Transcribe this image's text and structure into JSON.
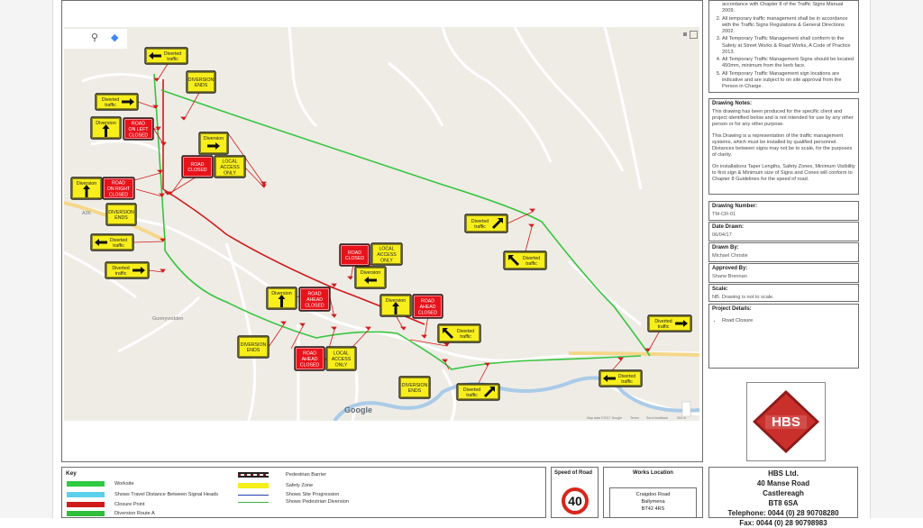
{
  "traffic_notes": {
    "items": [
      "accordance with Chapter 8 of the Traffic Signs Manual 2009.",
      "All temporary traffic management shall be in accordance with the Traffic Signs Regulations & General Directions 2002.",
      "All Temporary Traffic Management shall conform to the Safety at Street Works & Road Works, A Code of Practice 2013.",
      "All Temporary Traffic Management Signs should be located 450mm, minimum from the kerb face.",
      "All Temporary Traffic Management sign locations are indicative and are subject to on site approval from the Person in Charge."
    ],
    "numbers": [
      "2.",
      "3.",
      "4.",
      "5."
    ]
  },
  "drawing_notes": {
    "title": "Drawing Notes:",
    "paragraphs": [
      "This drawing has been produced for the specific client and project identified below and is not intended for use by any other person or for any other purpose.",
      "This Drawing is a representation of the traffic management systems, which must be installed by qualified personnel. Distances between signs may not be to scale, for the purposes of clarity.",
      "On installations Taper Lengths, Safety Zones, Minimum Visibility to first sign & Minimum size of Signs and Cones will conform to Chapter 8 Guidelines for the speed of road."
    ]
  },
  "fields": {
    "drawing_number_label": "Drawing Number:",
    "drawing_number": "TM-CR-01",
    "date_label": "Date Drawn:",
    "date": "06/04/17",
    "drawn_by_label": "Drawn By:",
    "drawn_by": "Michael Christie",
    "approved_by_label": "Approved By:",
    "approved_by": "Shane Brennan",
    "scale_label": "Scale:",
    "scale": "NB. Drawing is not to scale.",
    "project_label": "Project Details:",
    "project": "Road Closure"
  },
  "logo": {
    "text": "HBS",
    "color": "#c9302c"
  },
  "key": {
    "title": "Key",
    "items": [
      {
        "label": "Worksite",
        "color": "#2ecc40"
      },
      {
        "label": "Shows Travel Distance Between Signal Heads",
        "color": "#5ad0ec"
      },
      {
        "label": "Closure Point",
        "color": "#d11a1a"
      },
      {
        "label": "Diversion Route A",
        "color": "#2fbf3c"
      },
      {
        "label": "Pedestrian Barrier",
        "color": "#222222"
      },
      {
        "label": "Safety Zone",
        "color": "#f4ef19"
      },
      {
        "label": "Shows Site Progression",
        "color": "#1f3fae"
      },
      {
        "label": "Shows Pedestrian Diversion",
        "color": "#3cb04a"
      }
    ]
  },
  "speed": {
    "label": "Speed of Road",
    "value": "40"
  },
  "works_location": {
    "label": "Works Location",
    "line1": "Craigdoo Road",
    "line2": "Ballymena",
    "line3": "BT42 4RS"
  },
  "company": {
    "name": "HBS Ltd.",
    "line1": "40 Manse Road",
    "line2": "Castlereagh",
    "line3": "BT8 6SA",
    "phone": "Telephone: 0044 (0) 28 90708280",
    "fax": "Fax: 0044 (0) 28 90798983"
  },
  "map": {
    "google": "Google",
    "map_data": "Map data ©2017 Google",
    "terms": "Terms",
    "feedback": "Send feedback",
    "scale_bar": "500 m",
    "place": "Gunnyvodden",
    "road_label": "A36",
    "signs": {
      "diverted_traffic": [
        "Diverted",
        "traffic"
      ],
      "diversion_ends": [
        "DIVERSION",
        "ENDS"
      ],
      "diversion": "Diversion",
      "road_on_left_closed": [
        "ROAD",
        "ON LEFT",
        "CLOSED"
      ],
      "road_on_right_closed": [
        "ROAD",
        "ON RIGHT",
        "CLOSED"
      ],
      "road_closed": [
        "ROAD",
        "CLOSED"
      ],
      "local_access_only": [
        "LOCAL",
        "ACCESS",
        "ONLY"
      ],
      "road_ahead_closed": [
        "ROAD",
        "AHEAD",
        "CLOSED"
      ]
    }
  }
}
